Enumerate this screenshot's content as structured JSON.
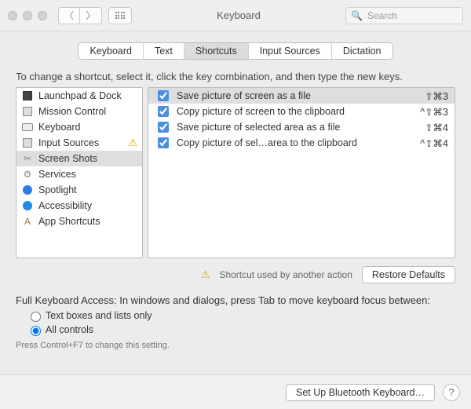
{
  "window": {
    "title": "Keyboard",
    "search_placeholder": "Search"
  },
  "tabs": [
    {
      "label": "Keyboard",
      "selected": false
    },
    {
      "label": "Text",
      "selected": false
    },
    {
      "label": "Shortcuts",
      "selected": true
    },
    {
      "label": "Input Sources",
      "selected": false
    },
    {
      "label": "Dictation",
      "selected": false
    }
  ],
  "instruction": "To change a shortcut, select it, click the key combination, and then type the new keys.",
  "categories": [
    {
      "label": "Launchpad & Dock",
      "warning": false
    },
    {
      "label": "Mission Control",
      "warning": false
    },
    {
      "label": "Keyboard",
      "warning": false
    },
    {
      "label": "Input Sources",
      "warning": true
    },
    {
      "label": "Screen Shots",
      "warning": false,
      "selected": true
    },
    {
      "label": "Services",
      "warning": false
    },
    {
      "label": "Spotlight",
      "warning": false
    },
    {
      "label": "Accessibility",
      "warning": false
    },
    {
      "label": "App Shortcuts",
      "warning": false
    }
  ],
  "shortcuts": [
    {
      "checked": true,
      "label": "Save picture of screen as a file",
      "keys": "⇧⌘3",
      "selected": true
    },
    {
      "checked": true,
      "label": "Copy picture of screen to the clipboard",
      "keys": "^⇧⌘3"
    },
    {
      "checked": true,
      "label": "Save picture of selected area as a file",
      "keys": "⇧⌘4"
    },
    {
      "checked": true,
      "label": "Copy picture of sel…area to the clipboard",
      "keys": "^⇧⌘4"
    }
  ],
  "conflict_note": "Shortcut used by another action",
  "restore_label": "Restore Defaults",
  "fka": {
    "intro": "Full Keyboard Access: In windows and dialogs, press Tab to move keyboard focus between:",
    "option_a": "Text boxes and lists only",
    "option_b": "All controls",
    "hint": "Press Control+F7 to change this setting."
  },
  "footer": {
    "bt_label": "Set Up Bluetooth Keyboard…"
  }
}
